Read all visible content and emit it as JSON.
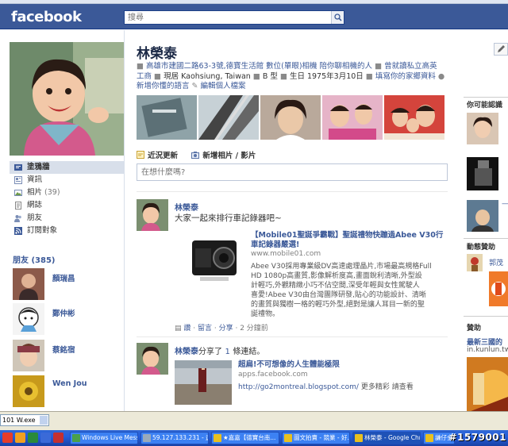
{
  "header": {
    "logo": "facebook",
    "search_placeholder": "搜尋"
  },
  "profile": {
    "name": "林榮泰",
    "info_line1": "高雄市建國二路63-3號,德寶生活館 數位(單眼)相機 陪你聊相機的人",
    "info_line1b": "曾就讀私立高英",
    "info_line2a": "工商",
    "info_line2b": "現居 Kaohsiung, Taiwan",
    "info_line2c": "B 型",
    "info_line2d": "生日 1975年3月10日",
    "info_line2e": "填寫你的家鄉資料",
    "info_line3a": "新增你懂的語言",
    "info_line3b": "編輯個人檔案"
  },
  "nav": {
    "items": [
      {
        "label": "塗鴉牆",
        "count": ""
      },
      {
        "label": "資訊",
        "count": ""
      },
      {
        "label": "相片",
        "count": "(39)"
      },
      {
        "label": "網誌",
        "count": ""
      },
      {
        "label": "朋友",
        "count": ""
      },
      {
        "label": "訂閱對象",
        "count": ""
      }
    ]
  },
  "friends": {
    "label": "朋友",
    "count": "(385)",
    "list": [
      "顏瑞昌",
      "鄭仲彬",
      "蔡銘宿",
      "Wen Jou"
    ]
  },
  "composer": {
    "tab_update": "近況更新",
    "tab_photo": "新增相片 / 影片",
    "placeholder": "在想什麼嗎?"
  },
  "posts": [
    {
      "author": "林榮泰",
      "message": "大家一起來排行車記錄器吧~",
      "link_title_1": "【Mobile01聖誕爭霸戰】聖誕禮物快蹦過Abee V30行",
      "link_title_2": "車記錄器嚴選!",
      "link_url": "www.mobile01.com",
      "desc": [
        "Abee V30採用專業級DV高速處理晶片,市場最高規格Full",
        "HD 1080p高畫質,影像解析度高,畫面銳利清晰,外型設",
        "計輕巧,外觀精緻小巧不佔空間,深受年輕與女性駕駛人",
        "喜愛!Abee V30由台灣團隊研發,貼心的功能設計、清晰",
        "的畫質與獨樹一格的輕巧外型,絕對是讓人耳目一新的聖",
        "誕禮物。"
      ],
      "action_like": "讚",
      "action_comment": "留言",
      "action_share": "分享",
      "time": "2 分鐘前"
    },
    {
      "author": "林榮泰",
      "action_text": "分享了",
      "count": "1",
      "count_suffix": "條連結。",
      "link_title": "超扁!不可想像的人生體能極限",
      "link_url": "apps.facebook.com",
      "link_extra": "http://go2montreal.blogspot.com/",
      "more_link": "更多精彩",
      "more_suffix": "請查看"
    }
  ],
  "right": {
    "pymk_header": "你可能認識",
    "ads_header": "動態贊助",
    "ad_name": "郭茂",
    "sponsored_header": "贊助",
    "sponsored_title": "最新三國的",
    "sponsored_url": "in.kunlun.tw",
    "dash": "—"
  },
  "statusbar": {
    "field": "101 W.exe"
  },
  "taskbar": {
    "tasks": [
      "Windows Live Messen...",
      "59.127.133.231 - 遠...",
      "★嘉嘉【德寶台南...",
      "圖文拍賣 - 競業 - 好...",
      "林榮泰 - Google Chro...",
      "謙仔金句..."
    ]
  },
  "watermark": "#1579001"
}
